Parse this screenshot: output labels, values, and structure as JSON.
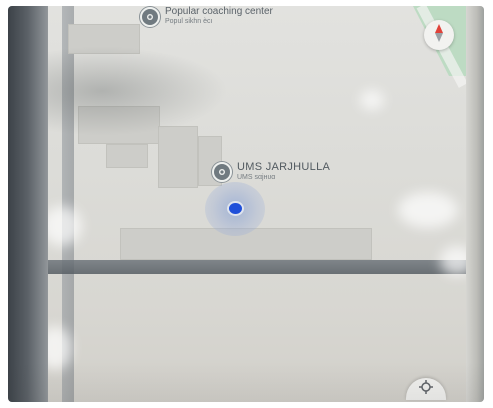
{
  "map": {
    "pois": [
      {
        "name": "Popular coaching center",
        "subtitle": "Popul sikhn ѐcı",
        "icon": "poi-icon"
      },
      {
        "name": "UMS JARJHULLA",
        "subtitle": "UMS ѕαjнυα",
        "icon": "poi-icon"
      }
    ],
    "controls": {
      "compass_icon": "compass-icon",
      "recenter_icon": "my-location-icon"
    }
  },
  "colors": {
    "location_dot": "#1f4fd9",
    "park": "#b9dac0",
    "map_background": "#dcdcd8",
    "road": "#565d63"
  }
}
